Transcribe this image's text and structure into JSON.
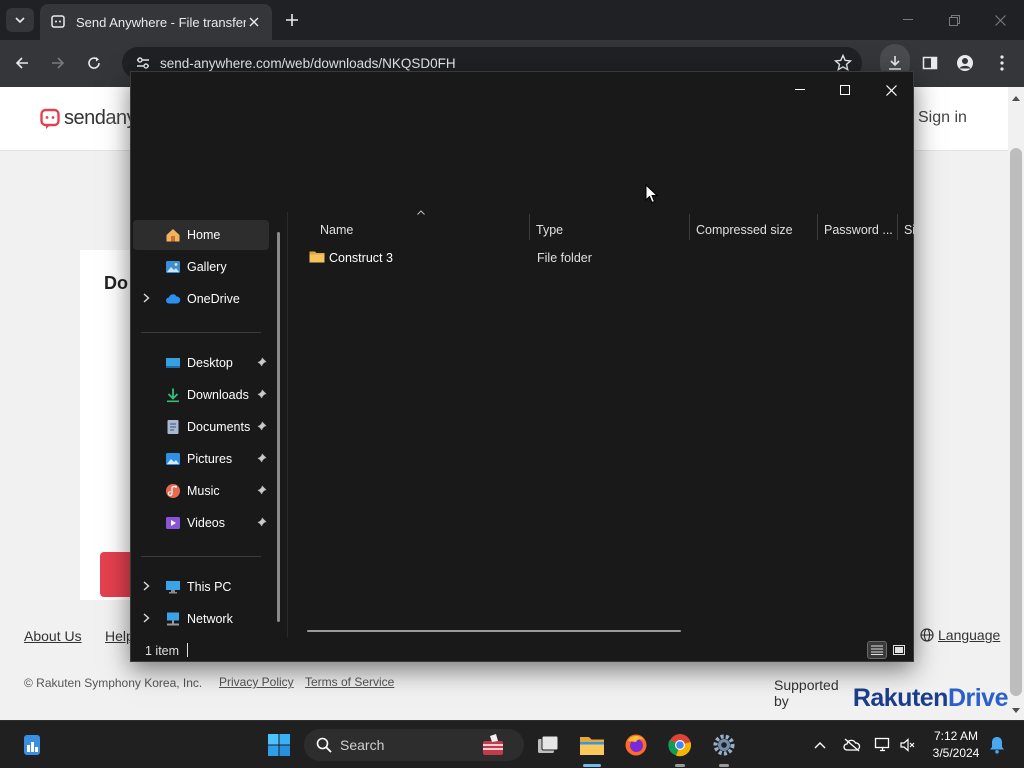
{
  "browser": {
    "tab_title": "Send Anywhere - File transfer",
    "url": "send-anywhere.com/web/downloads/NKQSD0FH"
  },
  "page": {
    "logo_send": "send",
    "logo_any": "any",
    "signin": "Sign in",
    "card_title": "Do",
    "footer": {
      "about": "About Us",
      "help": "Help",
      "language": "Language",
      "copyright": "© Rakuten Symphony Korea, Inc.",
      "privacy": "Privacy Policy",
      "terms": "Terms of Service",
      "supported_by": "Supported by",
      "brand_rakuten": "Rakuten",
      "brand_drive": "Drive"
    }
  },
  "dialog": {
    "nav": [
      {
        "label": "Home",
        "icon": "home-icon",
        "selected": true
      },
      {
        "label": "Gallery",
        "icon": "gallery-icon"
      },
      {
        "label": "OneDrive",
        "icon": "cloud-icon",
        "expandable": true
      },
      {
        "label": "Desktop",
        "icon": "desktop-icon",
        "pinned": true
      },
      {
        "label": "Downloads",
        "icon": "download-icon",
        "pinned": true
      },
      {
        "label": "Documents",
        "icon": "document-icon",
        "pinned": true
      },
      {
        "label": "Pictures",
        "icon": "picture-icon",
        "pinned": true
      },
      {
        "label": "Music",
        "icon": "music-icon",
        "pinned": true
      },
      {
        "label": "Videos",
        "icon": "video-icon",
        "pinned": true
      },
      {
        "label": "This PC",
        "icon": "computer-icon",
        "expandable": true
      },
      {
        "label": "Network",
        "icon": "network-icon",
        "expandable": true
      }
    ],
    "columns": [
      "Name",
      "Type",
      "Compressed size",
      "Password ...",
      "Si"
    ],
    "rows": [
      {
        "name": "Construct 3",
        "type": "File folder",
        "icon": "folder-icon"
      }
    ],
    "status": "1 item"
  },
  "taskbar": {
    "search_placeholder": "Search",
    "time": "7:12 AM",
    "date": "3/5/2024"
  }
}
